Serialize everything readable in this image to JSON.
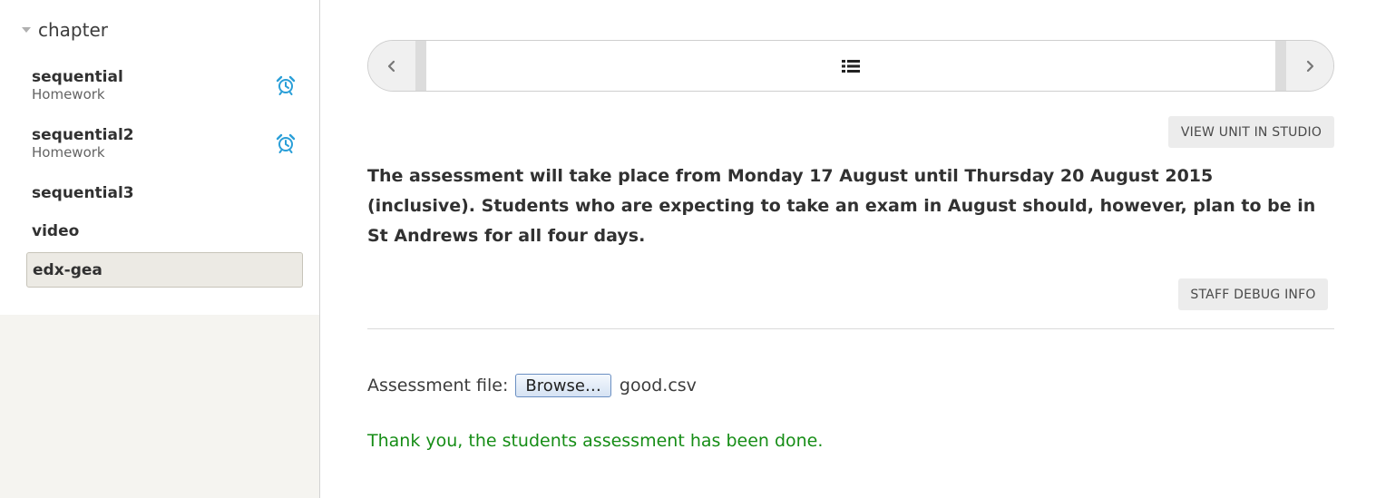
{
  "sidebar": {
    "chapter_title": "chapter",
    "items": [
      {
        "title": "sequential",
        "subtitle": "Homework",
        "icon": "alarm-clock-icon"
      },
      {
        "title": "sequential2",
        "subtitle": "Homework",
        "icon": "alarm-clock-icon"
      },
      {
        "title": "sequential3"
      },
      {
        "title": "video"
      },
      {
        "title": "edx-gea",
        "active": true
      }
    ]
  },
  "main": {
    "nav_center_icon": "list-icon",
    "view_in_studio_label": "VIEW UNIT IN STUDIO",
    "announcement": "The assessment  will take place from Monday 17 August until Thursday 20 August 2015 (inclusive). Students who are expecting to take an exam in August should, however, plan to be in St Andrews for all four days.",
    "staff_debug_label": "STAFF DEBUG INFO",
    "file_label": "Assessment file:",
    "browse_label": "Browse…",
    "file_name": "good.csv",
    "success_message": "Thank you, the students assessment has been done."
  },
  "colors": {
    "accent_icon": "#2a9fd8",
    "success": "#168d16",
    "sidebar_bg": "#f5f4f0"
  }
}
